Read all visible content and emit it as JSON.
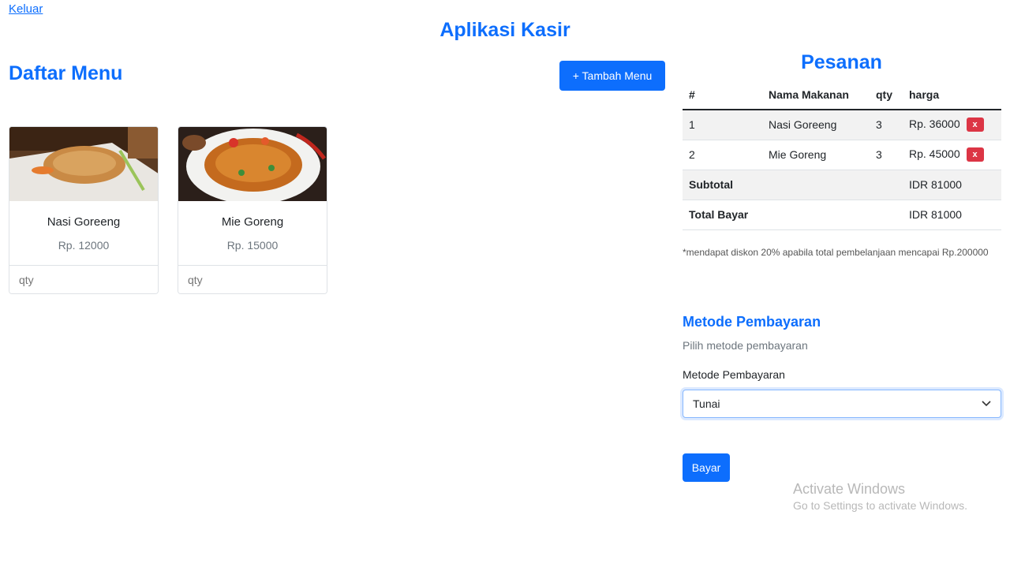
{
  "header": {
    "logout_link": "Keluar",
    "app_title": "Aplikasi Kasir"
  },
  "menu": {
    "title": "Daftar Menu",
    "add_button": "+ Tambah Menu",
    "items": [
      {
        "name": "Nasi Goreeng",
        "price": "Rp. 12000",
        "qty_placeholder": "qty",
        "add_label": "+"
      },
      {
        "name": "Mie Goreng",
        "price": "Rp. 15000",
        "qty_placeholder": "qty",
        "add_label": "+"
      }
    ]
  },
  "orders": {
    "title": "Pesanan",
    "columns": [
      "#",
      "Nama Makanan",
      "qty",
      "harga"
    ],
    "rows": [
      {
        "no": "1",
        "name": "Nasi Goreeng",
        "qty": "3",
        "price": "Rp. 36000",
        "delete_label": "x"
      },
      {
        "no": "2",
        "name": "Mie Goreng",
        "qty": "3",
        "price": "Rp. 45000",
        "delete_label": "x"
      }
    ],
    "subtotal_label": "Subtotal",
    "subtotal_value": "IDR 81000",
    "total_label": "Total Bayar",
    "total_value": "IDR 81000",
    "note": "*mendapat diskon 20% apabila total pembelanjaan mencapai Rp.200000"
  },
  "payment": {
    "title": "Metode Pembayaran",
    "subtitle": "Pilih metode pembayaran",
    "label": "Metode Pembayaran",
    "selected": "Tunai",
    "pay_button": "Bayar"
  },
  "watermark": {
    "line1": "Activate Windows",
    "line2": "Go to Settings to activate Windows."
  },
  "colors": {
    "primary": "#0d6efd",
    "danger": "#dc3545",
    "muted": "#6c757d"
  },
  "icons": [
    "chevron-down-icon"
  ]
}
